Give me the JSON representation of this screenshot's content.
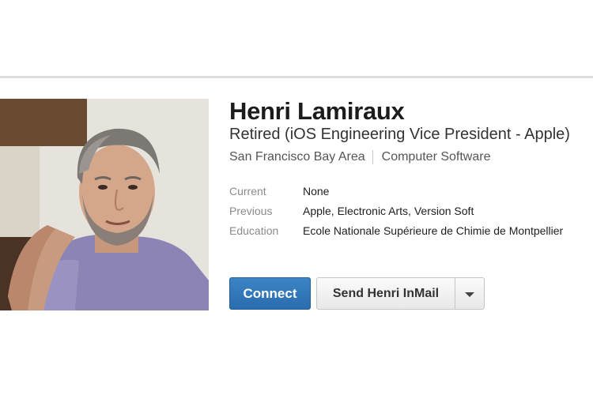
{
  "profile": {
    "name": "Henri Lamiraux",
    "headline": "Retired (iOS Engineering Vice President - Apple)",
    "location": "San Francisco Bay Area",
    "industry": "Computer Software",
    "details": [
      {
        "label": "Current",
        "value": "None"
      },
      {
        "label": "Previous",
        "value": "Apple, Electronic Arts, Version Soft"
      },
      {
        "label": "Education",
        "value": "Ecole Nationale Supérieure de Chimie de Montpellier"
      }
    ]
  },
  "actions": {
    "connect_label": "Connect",
    "inmail_label": "Send Henri InMail",
    "dropdown_icon": "chevron-down-icon"
  },
  "colors": {
    "connect_blue": "#2f74b8",
    "name_text": "#1c1c1c"
  }
}
